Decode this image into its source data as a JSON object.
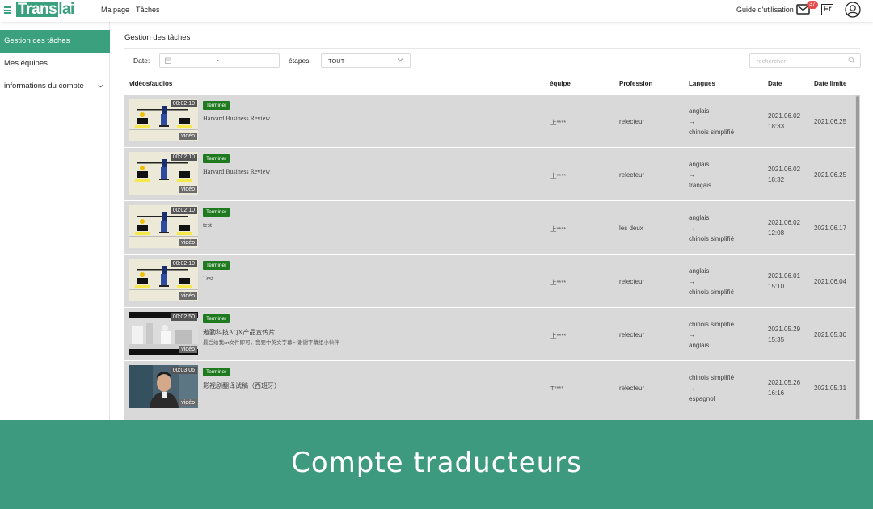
{
  "header": {
    "logo_boxed": "Trans",
    "logo_rest": "lai",
    "nav": [
      "Ma page",
      "Tâches"
    ],
    "guide": "Guide d'utilisation",
    "mail_count": "37",
    "lang": "Fr"
  },
  "sidebar": {
    "items": [
      {
        "label": "Gestion des tâches",
        "active": true
      },
      {
        "label": "Mes équipes",
        "active": false
      },
      {
        "label": "informations du compte",
        "active": false
      }
    ]
  },
  "main": {
    "title": "Gestion des tâches",
    "filters": {
      "date_label": "Date:",
      "date_separator": "-",
      "stage_label": "étapes:",
      "stage_value": "TOUT",
      "search_placeholder": "rechercher"
    },
    "columns": [
      "vidéos/audios",
      "équipe",
      "Profession",
      "Langues",
      "Date",
      "Date limite"
    ],
    "rows": [
      {
        "duration": "00:02:10",
        "badge": "vidéo",
        "status": "Terminer",
        "title": "Harvard Business Review",
        "subtitle": "",
        "team": "上****",
        "profession": "relecteur",
        "lang_from": "anglais",
        "arrow": "→",
        "lang_to": "chinois simplifié",
        "date": "2021.06.02",
        "time": "18:33",
        "deadline": "2021.06.25",
        "thumb": "light"
      },
      {
        "duration": "00:02:10",
        "badge": "vidéo",
        "status": "Terminer",
        "title": "Harvard Business Review",
        "subtitle": "",
        "team": "上****",
        "profession": "relecteur",
        "lang_from": "anglais",
        "arrow": "→",
        "lang_to": "français",
        "date": "2021.06.02",
        "time": "18:32",
        "deadline": "2021.06.25",
        "thumb": "light"
      },
      {
        "duration": "00:02:10",
        "badge": "vidéo",
        "status": "Terminer",
        "title": "test",
        "subtitle": "",
        "team": "上****",
        "profession": "les deux",
        "lang_from": "anglais",
        "arrow": "→",
        "lang_to": "chinois simplifié",
        "date": "2021.06.02",
        "time": "12:08",
        "deadline": "2021.06.17",
        "thumb": "light"
      },
      {
        "duration": "00:02:10",
        "badge": "vidéo",
        "status": "Terminer",
        "title": "Test",
        "subtitle": "",
        "team": "上****",
        "profession": "relecteur",
        "lang_from": "anglais",
        "arrow": "→",
        "lang_to": "chinois simplifié",
        "date": "2021.06.01",
        "time": "15:10",
        "deadline": "2021.06.04",
        "thumb": "light"
      },
      {
        "duration": "00:02:50",
        "badge": "vidéo",
        "status": "Terminer",
        "title": "遨勤科技AQX产品宣传片",
        "subtitle": "最后给我srt文件即可，我要中英文字幕～谢谢字幕组小伙伴",
        "team": "上****",
        "profession": "relecteur",
        "lang_from": "chinois simplifié",
        "arrow": "→",
        "lang_to": "anglais",
        "date": "2021.05.29",
        "time": "15:35",
        "deadline": "2021.05.30",
        "thumb": "lab"
      },
      {
        "duration": "00:03:06",
        "badge": "vidéo",
        "status": "Terminer",
        "title": "影视剧翻译试稿（西班牙）",
        "subtitle": "",
        "team": "T****",
        "profession": "relecteur",
        "lang_from": "chinois simplifié",
        "arrow": "→",
        "lang_to": "espagnol",
        "date": "2021.05.26",
        "time": "16:16",
        "deadline": "2021.05.31",
        "thumb": "man"
      }
    ]
  },
  "banner": {
    "text": "Compte traducteurs"
  },
  "colors": {
    "accent": "#3aa07d",
    "banner": "#3e9a7f",
    "status": "#1f7a1f",
    "badge": "#e64a4a"
  }
}
